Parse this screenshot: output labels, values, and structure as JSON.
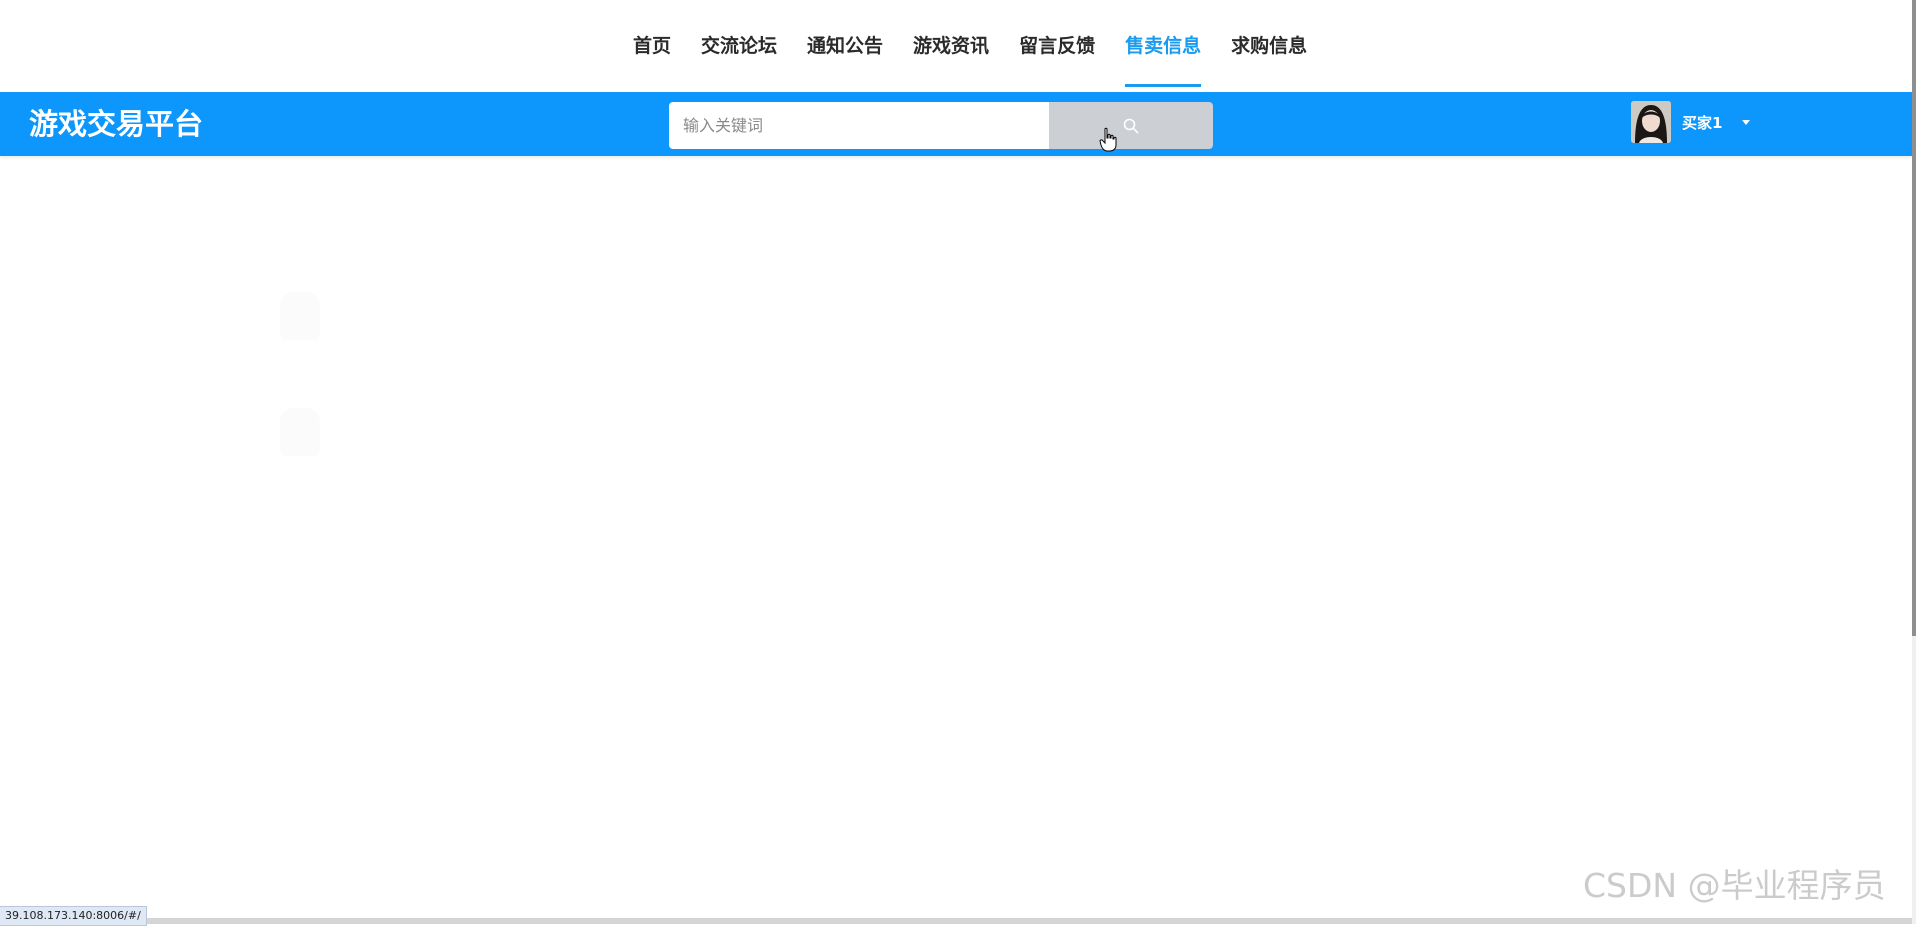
{
  "nav": {
    "items": [
      {
        "label": "首页",
        "active": false
      },
      {
        "label": "交流论坛",
        "active": false
      },
      {
        "label": "通知公告",
        "active": false
      },
      {
        "label": "游戏资讯",
        "active": false
      },
      {
        "label": "留言反馈",
        "active": false
      },
      {
        "label": "售卖信息",
        "active": true
      },
      {
        "label": "求购信息",
        "active": false
      }
    ],
    "active_color": "#1a9bf0"
  },
  "header": {
    "brand": "游戏交易平台",
    "background_color": "#0d97fc",
    "search": {
      "placeholder": "输入关键词",
      "value": "",
      "button_icon": "search-icon"
    },
    "user": {
      "name": "买家1",
      "avatar_icon": "avatar-photo",
      "dropdown_icon": "caret-down-icon"
    }
  },
  "status_bar": {
    "url": "39.108.173.140:8006/#/"
  },
  "watermark": "CSDN @毕业程序员"
}
